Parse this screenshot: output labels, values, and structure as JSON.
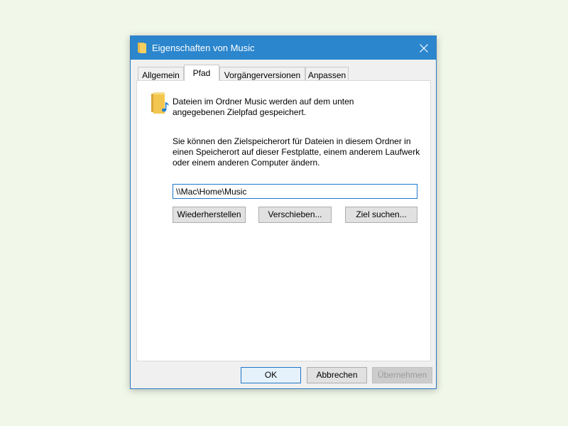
{
  "window": {
    "title": "Eigenschaften von Music",
    "title_icon": "folder-icon",
    "close_icon": "close-icon"
  },
  "tabs": [
    {
      "label": "Allgemein",
      "active": false
    },
    {
      "label": "Pfad",
      "active": true
    },
    {
      "label": "Vorgängerversionen",
      "active": false
    },
    {
      "label": "Anpassen",
      "active": false
    }
  ],
  "panel": {
    "icon": "music-folder-icon",
    "description": "Dateien im Ordner Music werden auf dem unten angegebenen Zielpfad gespeichert.",
    "instructions": "Sie können den Zielspeicherort für Dateien in diesem Ordner in einen Speicherort auf dieser Festplatte, einem anderem Laufwerk oder einem anderen Computer ändern.",
    "path_value": "\\\\Mac\\Home\\Music",
    "buttons": {
      "restore": "Wiederherstellen",
      "move": "Verschieben...",
      "find_target": "Ziel suchen..."
    }
  },
  "footer": {
    "ok": "OK",
    "cancel": "Abbrechen",
    "apply": "Übernehmen"
  },
  "colors": {
    "titlebar": "#2b86cd",
    "background": "#f1f8e9",
    "accent": "#1e78c8"
  }
}
